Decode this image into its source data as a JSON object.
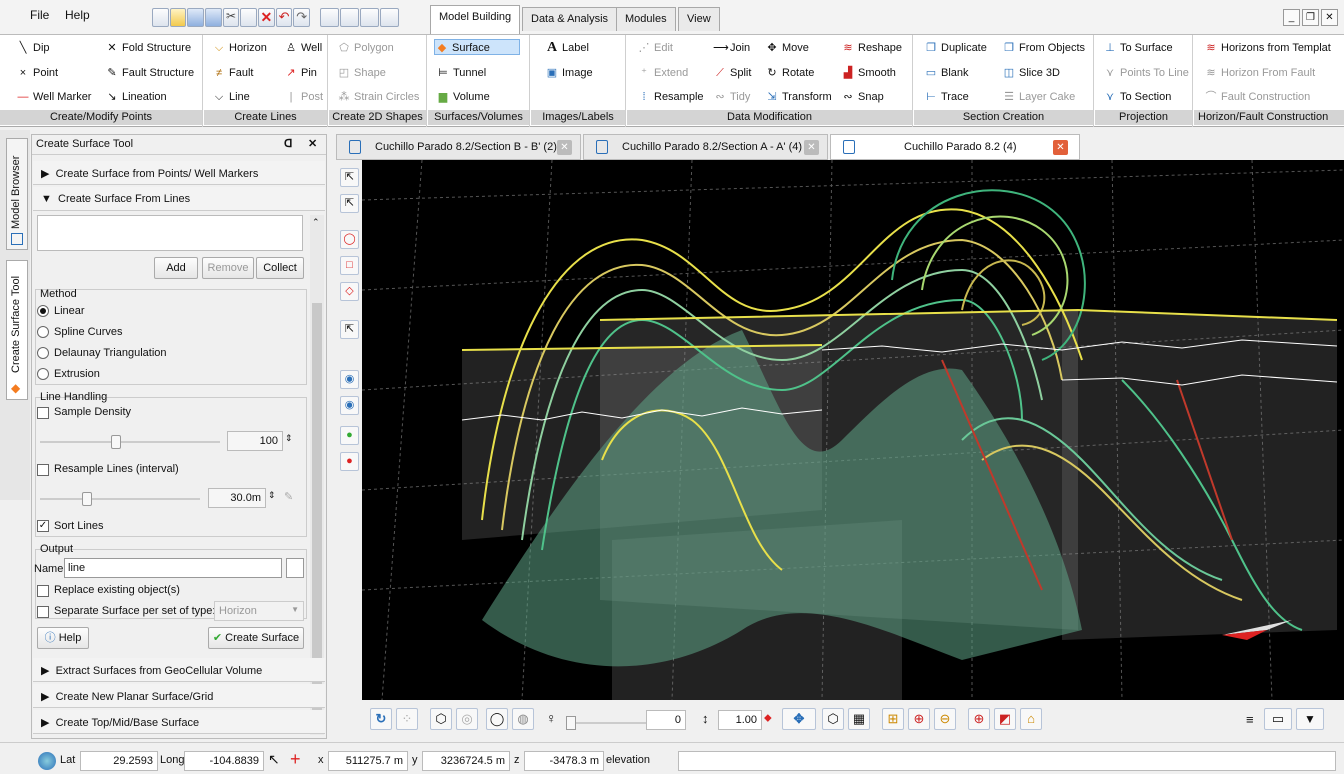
{
  "menu": {
    "file": "File",
    "help": "Help"
  },
  "colors": {
    "accent": "#f47c20",
    "selected": "#cde4fb",
    "surface": "#5fa487",
    "horizon": "#e8e04a",
    "fault": "#c0392b"
  },
  "ribbon_tabs": [
    "Model Building",
    "Data & Analysis",
    "Modules",
    "View"
  ],
  "ribbon": {
    "points": {
      "title": "Create/Modify Points",
      "dip": "Dip",
      "fold_structure": "Fold Structure",
      "point": "Point",
      "fault_structure": "Fault Structure",
      "well_marker": "Well Marker",
      "lineation": "Lineation"
    },
    "lines": {
      "title": "Create Lines",
      "horizon": "Horizon",
      "well": "Well",
      "fault": "Fault",
      "pin": "Pin",
      "line": "Line",
      "post": "Post"
    },
    "shapes": {
      "title": "Create 2D Shapes",
      "polygon": "Polygon",
      "shape": "Shape",
      "strain": "Strain Circles"
    },
    "surfaces": {
      "title": "Surfaces/Volumes",
      "surface": "Surface",
      "tunnel": "Tunnel",
      "volume": "Volume"
    },
    "images": {
      "title": "Images/Labels",
      "label": "Label",
      "image": "Image"
    },
    "modification": {
      "title": "Data Modification",
      "edit": "Edit",
      "join": "Join",
      "move": "Move",
      "reshape": "Reshape",
      "extend": "Extend",
      "split": "Split",
      "rotate": "Rotate",
      "smooth": "Smooth",
      "resample": "Resample",
      "tidy": "Tidy",
      "transform": "Transform",
      "snap": "Snap"
    },
    "section": {
      "title": "Section Creation",
      "duplicate": "Duplicate",
      "from_objects": "From Objects",
      "blank": "Blank",
      "slice3d": "Slice 3D",
      "trace": "Trace",
      "layer_cake": "Layer Cake"
    },
    "projection": {
      "title": "Projection",
      "to_surface": "To Surface",
      "points_to_line": "Points To Line",
      "to_section": "To Section"
    },
    "horizon_fault": {
      "title": "Horizon/Fault Construction",
      "from_template": "Horizons from Templat",
      "from_fault": "Horizon From Fault",
      "fault_construction": "Fault Construction"
    }
  },
  "side_tabs": {
    "model_browser": "Model Browser",
    "create_surface_tool": "Create Surface Tool"
  },
  "panel": {
    "title": "Create Surface Tool",
    "section_points": "Create Surface from Points/ Well Markers",
    "section_lines": "Create Surface From Lines",
    "add": "Add",
    "remove": "Remove",
    "collect": "Collect",
    "method_label": "Method",
    "methods": [
      "Linear",
      "Spline Curves",
      "Delaunay Triangulation",
      "Extrusion"
    ],
    "line_handling": "Line Handling",
    "sample_density": "Sample Density",
    "sample_density_value": "100",
    "sample_density_level": 0.42,
    "resample": "Resample Lines (interval)",
    "resample_value": "30.0m",
    "resample_level": 0.28,
    "sort_lines": "Sort Lines",
    "output": "Output",
    "name_label": "Name",
    "name_value": "line",
    "replace": "Replace existing object(s)",
    "separate": "Separate Surface per set of type:",
    "separate_type": "Horizon",
    "help": "Help",
    "create": "Create Surface",
    "section_extract": "Extract Surfaces from GeoCellular Volume",
    "section_planar": "Create New Planar Surface/Grid",
    "section_topmid": "Create Top/Mid/Base Surface"
  },
  "doc_tabs": [
    "Cuchillo Parado 8.2/Section B - B' (2)",
    "Cuchillo Parado 8.2/Section A - A' (4)",
    "Cuchillo Parado 8.2 (4)"
  ],
  "viewer": {
    "spin_value": "0",
    "scale_value": "1.00"
  },
  "status": {
    "lat_label": "Lat",
    "lat": "29.2593",
    "long_label": "Long",
    "long": "-104.8839",
    "x_label": "x",
    "x": "511275.7 m",
    "y_label": "y",
    "y": "3236724.5 m",
    "z_label": "z",
    "z": "-3478.3 m",
    "elevation_label": "elevation"
  }
}
